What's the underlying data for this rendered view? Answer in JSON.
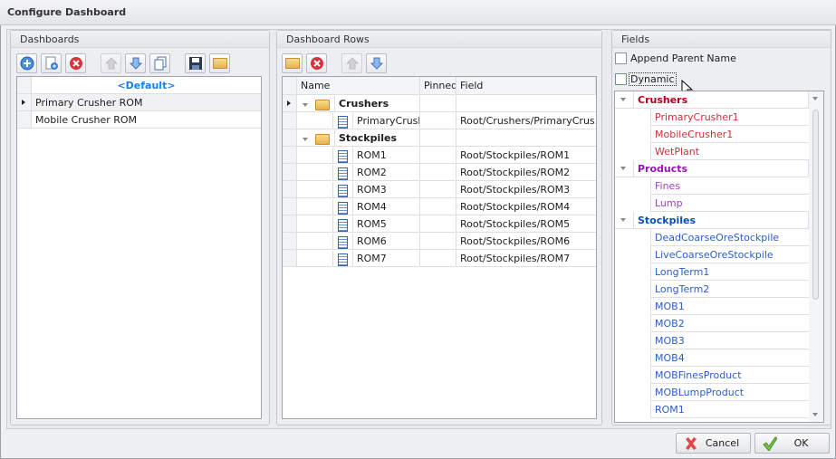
{
  "window": {
    "title": "Configure Dashboard"
  },
  "dashboards": {
    "title": "Dashboards",
    "rows": [
      {
        "name": "<Default>",
        "style": "default"
      },
      {
        "name": "Primary Crusher ROM",
        "current": true
      },
      {
        "name": "Mobile Crusher ROM"
      }
    ]
  },
  "rows": {
    "title": "Dashboard Rows",
    "columns": [
      "Name",
      "Pinned",
      "Field"
    ],
    "items": [
      {
        "type": "group",
        "name": "Crushers",
        "pinned": "",
        "field": "",
        "current": true
      },
      {
        "type": "item",
        "name": "PrimaryCrush...",
        "pinned": "",
        "field": "Root/Crushers/PrimaryCrus..."
      },
      {
        "type": "group",
        "name": "Stockpiles",
        "pinned": "",
        "field": ""
      },
      {
        "type": "item",
        "name": "ROM1",
        "pinned": "",
        "field": "Root/Stockpiles/ROM1"
      },
      {
        "type": "item",
        "name": "ROM2",
        "pinned": "",
        "field": "Root/Stockpiles/ROM2"
      },
      {
        "type": "item",
        "name": "ROM3",
        "pinned": "",
        "field": "Root/Stockpiles/ROM3"
      },
      {
        "type": "item",
        "name": "ROM4",
        "pinned": "",
        "field": "Root/Stockpiles/ROM4"
      },
      {
        "type": "item",
        "name": "ROM5",
        "pinned": "",
        "field": "Root/Stockpiles/ROM5"
      },
      {
        "type": "item",
        "name": "ROM6",
        "pinned": "",
        "field": "Root/Stockpiles/ROM6"
      },
      {
        "type": "item",
        "name": "ROM7",
        "pinned": "",
        "field": "Root/Stockpiles/ROM7"
      }
    ]
  },
  "fields": {
    "title": "Fields",
    "append_parent_name": {
      "label": "Append Parent Name",
      "checked": false
    },
    "dynamic": {
      "label": "Dynamic",
      "checked": false
    },
    "groups": [
      {
        "name": "Crushers",
        "color": "#b00020",
        "item_color": "#c8323c",
        "items": [
          "PrimaryCrusher1",
          "MobileCrusher1",
          "WetPlant"
        ]
      },
      {
        "name": "Products",
        "color": "#9a12b3",
        "item_color": "#a040c0",
        "items": [
          "Fines",
          "Lump"
        ]
      },
      {
        "name": "Stockpiles",
        "color": "#0a4fb5",
        "item_color": "#2a5ec4",
        "items": [
          "DeadCoarseOreStockpile",
          "LiveCoarseOreStockpile",
          "LongTerm1",
          "LongTerm2",
          "MOB1",
          "MOB2",
          "MOB3",
          "MOB4",
          "MOBFinesProduct",
          "MOBLumpProduct",
          "ROM1"
        ]
      }
    ]
  },
  "footer": {
    "cancel": "Cancel",
    "ok": "OK"
  }
}
